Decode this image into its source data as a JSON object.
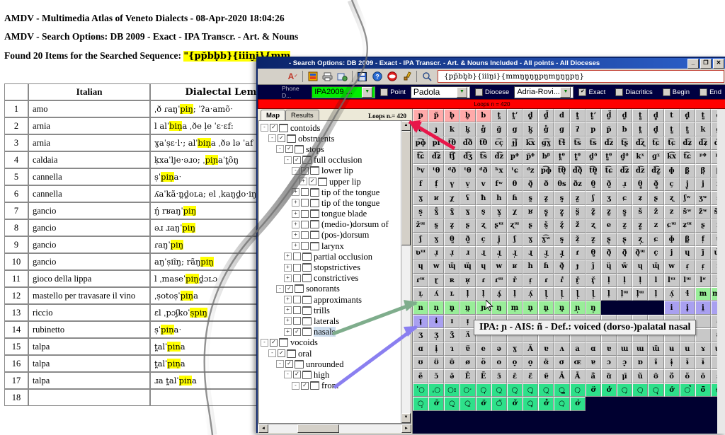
{
  "report": {
    "title_line": "AMDV - Multimedia Atlas of Veneto Dialects - 08-Apr-2020 18:04:26",
    "options_line": "AMDV - Search Options: DB 2009 - Exact - IPA Transcr. - Art. & Nouns",
    "found_prefix": "Found 20 Items for the Searched Sequence: ",
    "found_sequence": "\"{pp̆bb̥b}{iiin̮i}{mm",
    "table": {
      "headers": [
        "",
        "Italian",
        "Dialectal Lemma"
      ],
      "rows": [
        [
          "1",
          "amo",
          "ˌð ɾaŋˈpiŋ; ˈʔaˑamõˑ"
        ],
        [
          "2",
          "arnia",
          "l alˈbiṇa ˌðe ḷe ˈɛˑɛf:"
        ],
        [
          "3",
          "arnia",
          "ɣaˈṣɛˑlˑ; alˈbiṇa ˌðə lə ˈaf"
        ],
        [
          "4",
          "caldaia",
          "ḳxaˈljeˑəɹo; ˌpiɲaˈt̪õŋ"
        ],
        [
          "5",
          "cannella",
          "ṣˈpiṇaˑ"
        ],
        [
          "6",
          "cannella",
          "ʎaˈkãˑn̪d̪oʟa; el ˌkaŋd̪oˑiŋ; a"
        ],
        [
          "7",
          "gancio",
          "ŋ́ rʁaŋˈpiŋ"
        ],
        [
          "8",
          "gancio",
          "əɹ ɹaŋˈpiŋ"
        ],
        [
          "9",
          "gancio",
          "ɾaŋˈpiŋ"
        ],
        [
          "10",
          "gancio",
          "aŋˈṣiĩŋ; rãŋpiŋ"
        ],
        [
          "11",
          "gioco della lippa",
          "l ˌmaseˈpiŋd̪ɔʟɔ"
        ],
        [
          "12",
          "mastello per travasare il vino",
          "ˌṣotoṣˈpiṇa"
        ],
        [
          "13",
          "riccio",
          "ɛl ˌpɔʃkoˈṣpiŋ"
        ],
        [
          "14",
          "rubinetto",
          "ṣˈpiṇaˑ"
        ],
        [
          "15",
          "talpa",
          "t̪alˈpina"
        ],
        [
          "16",
          "talpa",
          "t̪alˈpiṇa"
        ],
        [
          "17",
          "talpa",
          "ɹa t̪alˈpina"
        ],
        [
          "18",
          "",
          ""
        ]
      ],
      "highlight_color": "#ffff00"
    }
  },
  "window": {
    "title": "- Search Options: DB 2009 - Exact - IPA Transcr. - Art. & Nouns Included - All points - All Dioceses",
    "buttons": {
      "minimize": "_",
      "maximize": "❐",
      "close": "✕"
    },
    "toolbar": {
      "icons": [
        "spell-check-icon",
        "database-icon",
        "printer-icon",
        "export-icon",
        "save-icon",
        "help-icon",
        "stop-icon",
        "brush-icon",
        "search-icon"
      ],
      "search_value": "{pp̆bb̥b}{iiin̮i}{mmŋn̪ŋn̪pŋmn̪ŋn̪pŋ}"
    },
    "options": {
      "phone_label": "Phone D...",
      "database_value": "IPA2009 ...",
      "point_check_label": "Point",
      "point_value": "Padola",
      "diocese_check_label": "Diocese",
      "diocese_value": "Adria-Rovi...",
      "exact_label": "Exact",
      "exact_checked": "✔",
      "diacritics_label": "Diacritics",
      "begin_label": "Begin",
      "end_label": "End"
    },
    "loops_bar": "Loops n = 420"
  },
  "left_panel": {
    "tabs": [
      {
        "label": "Map",
        "active": true
      },
      {
        "label": "Results",
        "active": false
      }
    ],
    "loops_label": "Loops n.= 420",
    "tree": [
      {
        "depth": 0,
        "exp": "-",
        "check": "✓",
        "label": "contoids",
        "selected": false
      },
      {
        "depth": 1,
        "exp": "-",
        "check": "✓",
        "label": "obstruents",
        "selected": false
      },
      {
        "depth": 2,
        "exp": "-",
        "check": "✓",
        "label": "stops",
        "selected": false
      },
      {
        "depth": 3,
        "exp": "-",
        "check": "✓",
        "label": "full occlusion",
        "selected": false
      },
      {
        "depth": 4,
        "exp": "-",
        "check": "✓",
        "label": "lower lip",
        "selected": false
      },
      {
        "depth": 5,
        "exp": "+",
        "check": "✓",
        "label": "upper lip",
        "selected": false
      },
      {
        "depth": 4,
        "exp": "+",
        "check": "",
        "label": "tip of the tongue",
        "selected": false
      },
      {
        "depth": 4,
        "exp": "+",
        "check": "",
        "label": "tip of the tongue",
        "selected": false
      },
      {
        "depth": 4,
        "exp": "+",
        "check": "",
        "label": "tongue blade",
        "selected": false
      },
      {
        "depth": 4,
        "exp": "+",
        "check": "",
        "label": "(medio-)dorsum of",
        "selected": false
      },
      {
        "depth": 4,
        "exp": "+",
        "check": "",
        "label": "(pos-)dorsum",
        "selected": false
      },
      {
        "depth": 4,
        "exp": "+",
        "check": "",
        "label": "larynx",
        "selected": false
      },
      {
        "depth": 3,
        "exp": "+",
        "check": "",
        "label": "partial occlusion",
        "selected": false
      },
      {
        "depth": 3,
        "exp": "+",
        "check": "",
        "label": "stopstrictives",
        "selected": false
      },
      {
        "depth": 3,
        "exp": "+",
        "check": "",
        "label": "constrictives",
        "selected": false
      },
      {
        "depth": 2,
        "exp": "-",
        "check": "✓",
        "label": "sonorants",
        "selected": false
      },
      {
        "depth": 3,
        "exp": "+",
        "check": "",
        "label": "approximants",
        "selected": false
      },
      {
        "depth": 3,
        "exp": "+",
        "check": "",
        "label": "trills",
        "selected": false
      },
      {
        "depth": 3,
        "exp": "+",
        "check": "",
        "label": "laterals",
        "selected": false
      },
      {
        "depth": 3,
        "exp": "+",
        "check": "✓",
        "label": "nasals",
        "selected": true
      },
      {
        "depth": 0,
        "exp": "-",
        "check": "✓",
        "label": "vocoids",
        "selected": false
      },
      {
        "depth": 1,
        "exp": "-",
        "check": "✓",
        "label": "oral",
        "selected": false
      },
      {
        "depth": 2,
        "exp": "-",
        "check": "✓",
        "label": "unrounded",
        "selected": false
      },
      {
        "depth": 3,
        "exp": "-",
        "check": "✓",
        "label": "high",
        "selected": false
      },
      {
        "depth": 4,
        "exp": "-",
        "check": "✓",
        "label": "front",
        "selected": false
      }
    ]
  },
  "tooltip": {
    "text": "IPA: ɲ - AIS: ñ - Def.: voiced (dorso-)palatal nasal"
  },
  "ipa_grid": {
    "colors": {
      "default": "#c8c8c8",
      "pink": "#ffaaaa",
      "green": "#99ee99",
      "green2": "#2ee08a",
      "violet": "#a9a0f0",
      "blank": "#000030"
    },
    "rows": [
      {
        "cells": [
          "p",
          "p̆",
          "b̥",
          "b̥",
          "b",
          "t̪",
          "t̪ʼ",
          "d̪̥",
          "d̪̈",
          "d",
          "t̺",
          "t̺ʼ",
          "d̺̈",
          "d̺",
          "t̻",
          "d̻",
          "t",
          "d̪",
          "t̺",
          "d̺"
        ],
        "styles": [
          "pink",
          "pink",
          "pink",
          "pink",
          "pink",
          "",
          "",
          "",
          "",
          "",
          "",
          "",
          "",
          "",
          "",
          "",
          "",
          "",
          "",
          ""
        ]
      },
      {
        "cells": [
          "c",
          "ɟ",
          "k",
          "k̥",
          "g̊",
          "g̈",
          "g",
          "k̺",
          "g̊",
          "ɡ",
          "ʔ",
          "p",
          "p̆",
          "b",
          "t̪",
          "d̪",
          "t̺",
          "t̺",
          "k",
          "g"
        ],
        "styles": []
      },
      {
        "cells": [
          "p͡ɸ",
          "p͡f",
          "t͡θ",
          "d͡ð",
          "t͡θ",
          "c͡ç",
          "ɟ͡j",
          "k͡x",
          "ɡ͡ɣ",
          "t͡ɬ",
          "t͡s",
          "t͡s",
          "d͡z",
          "t͡ʂ",
          "d͡ʐ",
          "t͡ɕ",
          "t͡ɕ",
          "d͡ʑ",
          "d͡ʑ",
          "d͡z"
        ],
        "styles": []
      },
      {
        "cells": [
          "t͡ɕ",
          "d͡ʑ",
          "t͡ʃ",
          "d͡ʒ",
          "t͡s",
          "d͡z",
          "pᶲ",
          "p̆ᶲ",
          "bᵝ",
          "t̪ᶿ",
          "t̺ᶿ",
          "d̪ᶞ",
          "t̺ᶿ",
          "d̺ᶞ",
          "kˣ",
          "ɡˠ",
          "k͡x",
          "t͡ɕ",
          "ᵖᶲ",
          "ᵖf"
        ],
        "styles": []
      },
      {
        "cells": [
          "ᵇv",
          "ᵗθ",
          "ᵈð",
          "ᵗθ",
          "ᵈð",
          "ᵏx",
          "ᵗɕ",
          "ᵈz",
          "p͡ɸ",
          "t͡θ̬",
          "d͡ð̥",
          "t͡θ̺",
          "t͡ɕ",
          "d͡ʑ",
          "d͡z",
          "d͡z̺",
          "ɸ",
          "β̥",
          "β̩",
          "β"
        ],
        "styles": []
      },
      {
        "cells": [
          "f",
          "f̩",
          "v̥",
          "v̠",
          "v",
          "fʷ",
          "θ",
          "ð̥",
          "ð",
          "θs",
          "ðz",
          "θ̺",
          "ð̺",
          "ɹ̠",
          "θ̻",
          "ð̻",
          "ç",
          "j̥",
          "j",
          "x"
        ],
        "styles": []
      },
      {
        "cells": [
          "ɣ",
          "ʁ",
          "χ",
          "ʕ",
          "ħ",
          "h",
          "ɦ",
          "s̪",
          "z̪",
          "s̺",
          "z̺",
          "ʃ",
          "ʒ",
          "ɕ",
          "ʑ",
          "ʂ",
          "ʐ",
          "ʃʷ",
          "ʒʷ",
          "s̼"
        ],
        "styles": []
      },
      {
        "cells": [
          "s̝",
          "ɣ̊",
          "ɣ̈",
          "ɣ",
          "s̠",
          "ɣ̩",
          "χ",
          "ʁ",
          "s̻",
          "z̻",
          "s̪̈",
          "z̪̈",
          "z̺",
          "s̻",
          "š",
          "ž",
          "z",
          "s̃ʷ",
          "z̃ʷ",
          "s̃ᵚ"
        ],
        "styles": []
      },
      {
        "cells": [
          "z̃ᵚ",
          "s̪",
          "z̪",
          "ʂ",
          "ʐ",
          "ʂᵚ",
          "ʐᵚ",
          "ʂ",
          "š̬",
          "ž̥",
          "ž̈",
          "ʐ",
          "e",
          "z̺",
          "z̻",
          "z",
          "ɕᵚ",
          "ʑᵚ",
          "ʂ",
          "ʐ̺"
        ],
        "styles": []
      },
      {
        "cells": [
          "ʃ",
          "ɣ",
          "θ̺",
          "ð̺",
          "ç",
          "j̩",
          "ʃ",
          "ɣ",
          "ɣ͡ʷ",
          "s̺",
          "ž̩",
          "z̺",
          "ʂ̩",
          "ʂ̩",
          "ʐ̩",
          "ɕ",
          "ɸ",
          "β̥",
          "f̩",
          "ʋ"
        ],
        "styles": []
      },
      {
        "cells": [
          "ʋᵚ",
          "ɹ̩",
          "ɹ̩",
          "ɹ",
          "ɻ",
          "ɻ̩",
          "ɻ̩",
          "ɻ",
          "ɻ̬",
          "ɻ̥",
          "ɾ",
          "θ̺",
          "ð̥",
          "ð̥̩",
          "ð̥ᵚ",
          "ç",
          "j",
          "ɥ",
          "j̃",
          "ɥ͡ɻ"
        ],
        "styles": []
      },
      {
        "cells": [
          "ɥ",
          "w",
          "ɰ̈",
          "ɰ̈",
          "ɥ",
          "w",
          "ʁ",
          "h",
          "ɦ",
          "ð̥",
          "ɟ",
          "j̃",
          "ɥ̈",
          "w̃",
          "ɥ",
          "ɰ̈",
          "w",
          "ɾ̩",
          "ɾ̩",
          "r"
        ],
        "styles": []
      },
      {
        "cells": [
          "ɾᵚ",
          "ɽ",
          "ʀ",
          "ʁ̩",
          "ɾ",
          "ɾᵚ",
          "ř",
          "ɾ̩",
          "ɾ",
          "ɾ̽",
          "ř̬",
          "ř̥",
          "l̩",
          "l̩",
          "l̩",
          "l",
          "lᵚ",
          "lᵚ",
          "lʶ",
          "ʟ"
        ],
        "styles": []
      },
      {
        "cells": [
          "ʟ̩",
          "ʎ",
          "ʟ",
          "l̩",
          "l̩",
          "ʎ̥",
          "l̩",
          "ʎ̩",
          "ɭ̩",
          "ɭ̩",
          "ɭ̩",
          "ɭ̩",
          "l̩",
          "l̩ᵚ",
          "l̩ᵚ",
          "l̩",
          "ʎ̩",
          "ɬ",
          "m",
          "mŋ"
        ],
        "styles": [
          "",
          "",
          "",
          "",
          "",
          "",
          "",
          "",
          "",
          "",
          "",
          "",
          "",
          "",
          "",
          "",
          "",
          "",
          "green",
          "green"
        ]
      },
      {
        "cells": [
          "n",
          "n̩",
          "n̪",
          "n̪",
          "ɲ",
          "ŋ",
          "m̩",
          "n̥",
          "n̪",
          "n̪",
          "ɲ̩",
          "ŋ̩",
          "",
          "",
          "",
          "",
          "i",
          "i̥",
          "i̯",
          "ɪ"
        ],
        "styles": [
          "green",
          "green",
          "green",
          "green",
          "green",
          "green",
          "green",
          "green",
          "green",
          "green",
          "green",
          "green",
          "blank",
          "blank",
          "blank",
          "blank",
          "violet",
          "violet",
          "violet",
          "violet"
        ]
      },
      {
        "cells": [
          "ɪ̥",
          "ɨ",
          "ɪ",
          "ɪ̩",
          "",
          "",
          "",
          "",
          "",
          "",
          "",
          "",
          "",
          "",
          "",
          "",
          "",
          "",
          "",
          "ɛ̈"
        ],
        "styles": [
          "violet",
          "violet",
          "",
          "",
          "",
          "",
          "",
          "",
          "",
          "",
          "",
          "",
          "",
          "",
          "",
          "",
          "",
          "",
          "",
          ""
        ]
      },
      {
        "cells": [
          "ʒ",
          "ʒ̩",
          "ʒ̈",
          "ʌ̈",
          "",
          "",
          "",
          "",
          "",
          "",
          "",
          "",
          "",
          "",
          "",
          "",
          "",
          "",
          "",
          "a"
        ],
        "styles": []
      },
      {
        "cells": [
          "ɑ",
          "ɨ̩",
          "ɿ",
          "ɐ̈",
          "e",
          "ə",
          "ɣ",
          "Ä",
          "ɐ",
          "ʌ",
          "a",
          "ɑ",
          "ɐ",
          "ɯ",
          "ɯ",
          "ɯ̈",
          "ʉ",
          "u",
          "ɤ",
          "ɯ̈"
        ],
        "styles": []
      },
      {
        "cells": [
          "ʊ",
          "ʊ̈",
          "ʊ̈",
          "ø",
          "ö",
          "o",
          "o̞",
          "o̞",
          "ɞ̈",
          "σ",
          "ɶ",
          "ɐ",
          "ɔ",
          "ɔ̞",
          "ɒ",
          "ɨ̃",
          "ɨ̩",
          "ɨ̄",
          "ɨ̄",
          "ɨ̄"
        ],
        "styles": []
      },
      {
        "cells": [
          "ẽ",
          "ɔ̃",
          "ə̃",
          "Ē",
          "Ẽ",
          "ɜ̃",
          "ɛ̃",
          "ɛ̃̈",
          "ɐ̃",
          "Ā",
          "Ā",
          "ä̃",
          "ɑ̃",
          "μ̄",
          "ũ",
          "ʊ̃",
          "ö̃",
          "õ",
          "ō",
          "ɔ̃"
        ],
        "styles": []
      },
      {
        "cells": [
          "ˈ○",
          "ˌ○",
          "○:",
          "○ˑ",
          "○̩",
          "○̯",
          "○̮",
          "○̬",
          "○̭",
          "○̳",
          "○̣",
          "ơ̈",
          "ơ̽",
          "○̗",
          "○̖",
          "○̘",
          "ơ̑",
          "○̚",
          "ō̃",
          "○̴"
        ],
        "styles": [
          "green2",
          "green2",
          "green2",
          "green2",
          "green2",
          "green2",
          "green2",
          "green2",
          "green2",
          "green2",
          "green2",
          "green2",
          "green2",
          "green2",
          "green2",
          "green2",
          "green2",
          "green2",
          "green2",
          "green2"
        ]
      },
      {
        "cells": [
          "○̜",
          "ơ̄",
          "○̠",
          "○̤",
          "ơ̈",
          "○̆",
          "ơ̌",
          "○̥",
          "ơ̊",
          "○̦",
          "ơ̓",
          "",
          "",
          "",
          "",
          "",
          "",
          "",
          "",
          ""
        ],
        "styles": [
          "green2",
          "green2",
          "green2",
          "green2",
          "green2",
          "green2",
          "green2",
          "green2",
          "green2",
          "green2",
          "green2",
          "blank",
          "blank",
          "blank",
          "blank",
          "blank",
          "blank",
          "blank",
          "blank",
          "blank"
        ]
      }
    ]
  },
  "annotations": {
    "arrows": [
      {
        "name": "red-arrow",
        "color": "#e8174a"
      },
      {
        "name": "green-arrow",
        "color": "#7fad8c"
      },
      {
        "name": "blue-arrow",
        "color": "#8a7ff0"
      }
    ]
  }
}
